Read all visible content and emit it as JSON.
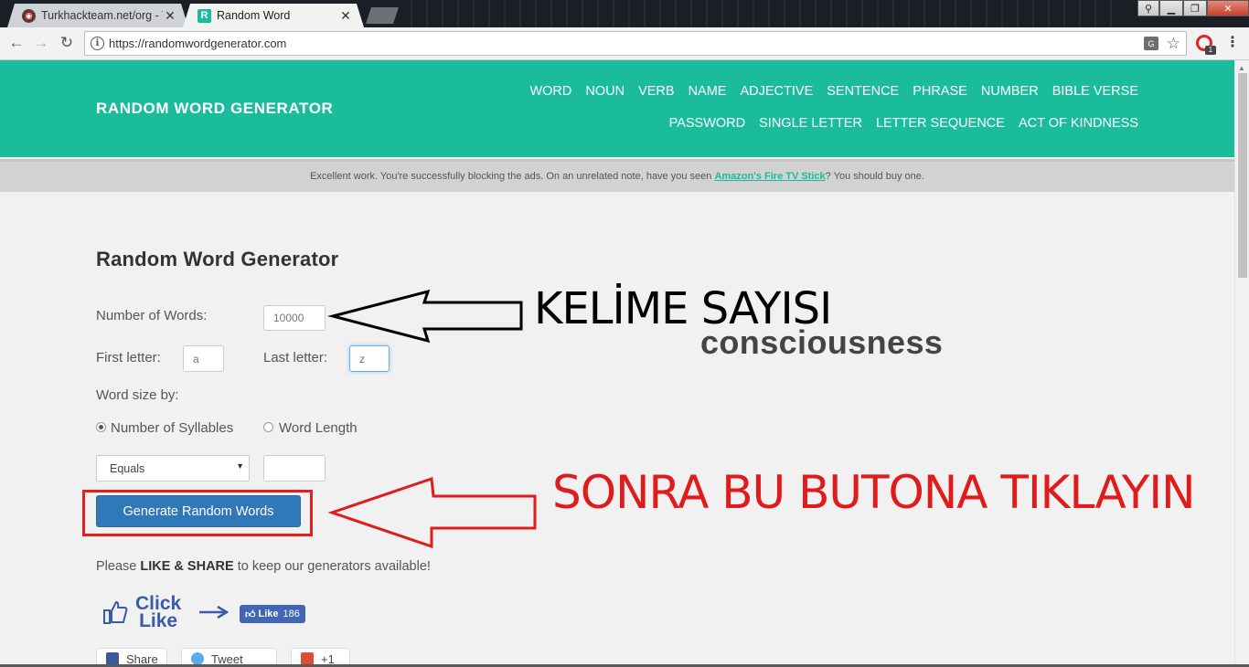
{
  "browser": {
    "tabs": [
      {
        "title": "Turkhackteam.net/org - T",
        "favicon": "tht-logo-icon",
        "active": false
      },
      {
        "title": "Random Word",
        "favicon": "R",
        "active": true
      }
    ],
    "url": "https://randomwordgenerator.com",
    "extension_badge": "1",
    "tab_close": "✕"
  },
  "site": {
    "logo": "RANDOM WORD GENERATOR",
    "nav_row1": [
      "WORD",
      "NOUN",
      "VERB",
      "NAME",
      "ADJECTIVE",
      "SENTENCE",
      "PHRASE",
      "NUMBER",
      "BIBLE VERSE"
    ],
    "nav_row2": [
      "PASSWORD",
      "SINGLE LETTER",
      "LETTER SEQUENCE",
      "ACT OF KINDNESS"
    ],
    "accent_color": "#1bbc9c"
  },
  "ad_notice": {
    "before": "Excellent work. You're successfully blocking the ads. On an unrelated note, have you seen ",
    "link": "Amazon's Fire TV Stick",
    "after": "? You should buy one."
  },
  "generator": {
    "title": "Random Word Generator",
    "number_label": "Number of Words:",
    "number_value": "10000",
    "first_letter_label": "First letter:",
    "first_letter_value": "a",
    "last_letter_label": "Last letter:",
    "last_letter_value": "z",
    "word_size_label": "Word size by:",
    "radio_syllables": "Number of Syllables",
    "radio_length": "Word Length",
    "selected_radio": "syllables",
    "select_value": "Equals",
    "size_value": "",
    "button_label": "Generate Random Words",
    "result_word": "consciousness"
  },
  "share": {
    "text_before": "Please ",
    "text_bold": "LIKE & SHARE",
    "text_after": " to keep our generators available!",
    "click_like_1": "Click",
    "click_like_2": "Like",
    "fb_like_label": "Like",
    "fb_like_count": "186",
    "buttons": [
      "Share",
      "Tweet",
      "+1"
    ]
  },
  "annotations": {
    "arrow_1_text": "KELİME SAYISI",
    "arrow_2_text": "SONRA BU BUTONA TIKLAYIN",
    "arrow_1_color": "#000000",
    "arrow_2_color": "#e01b1b"
  }
}
